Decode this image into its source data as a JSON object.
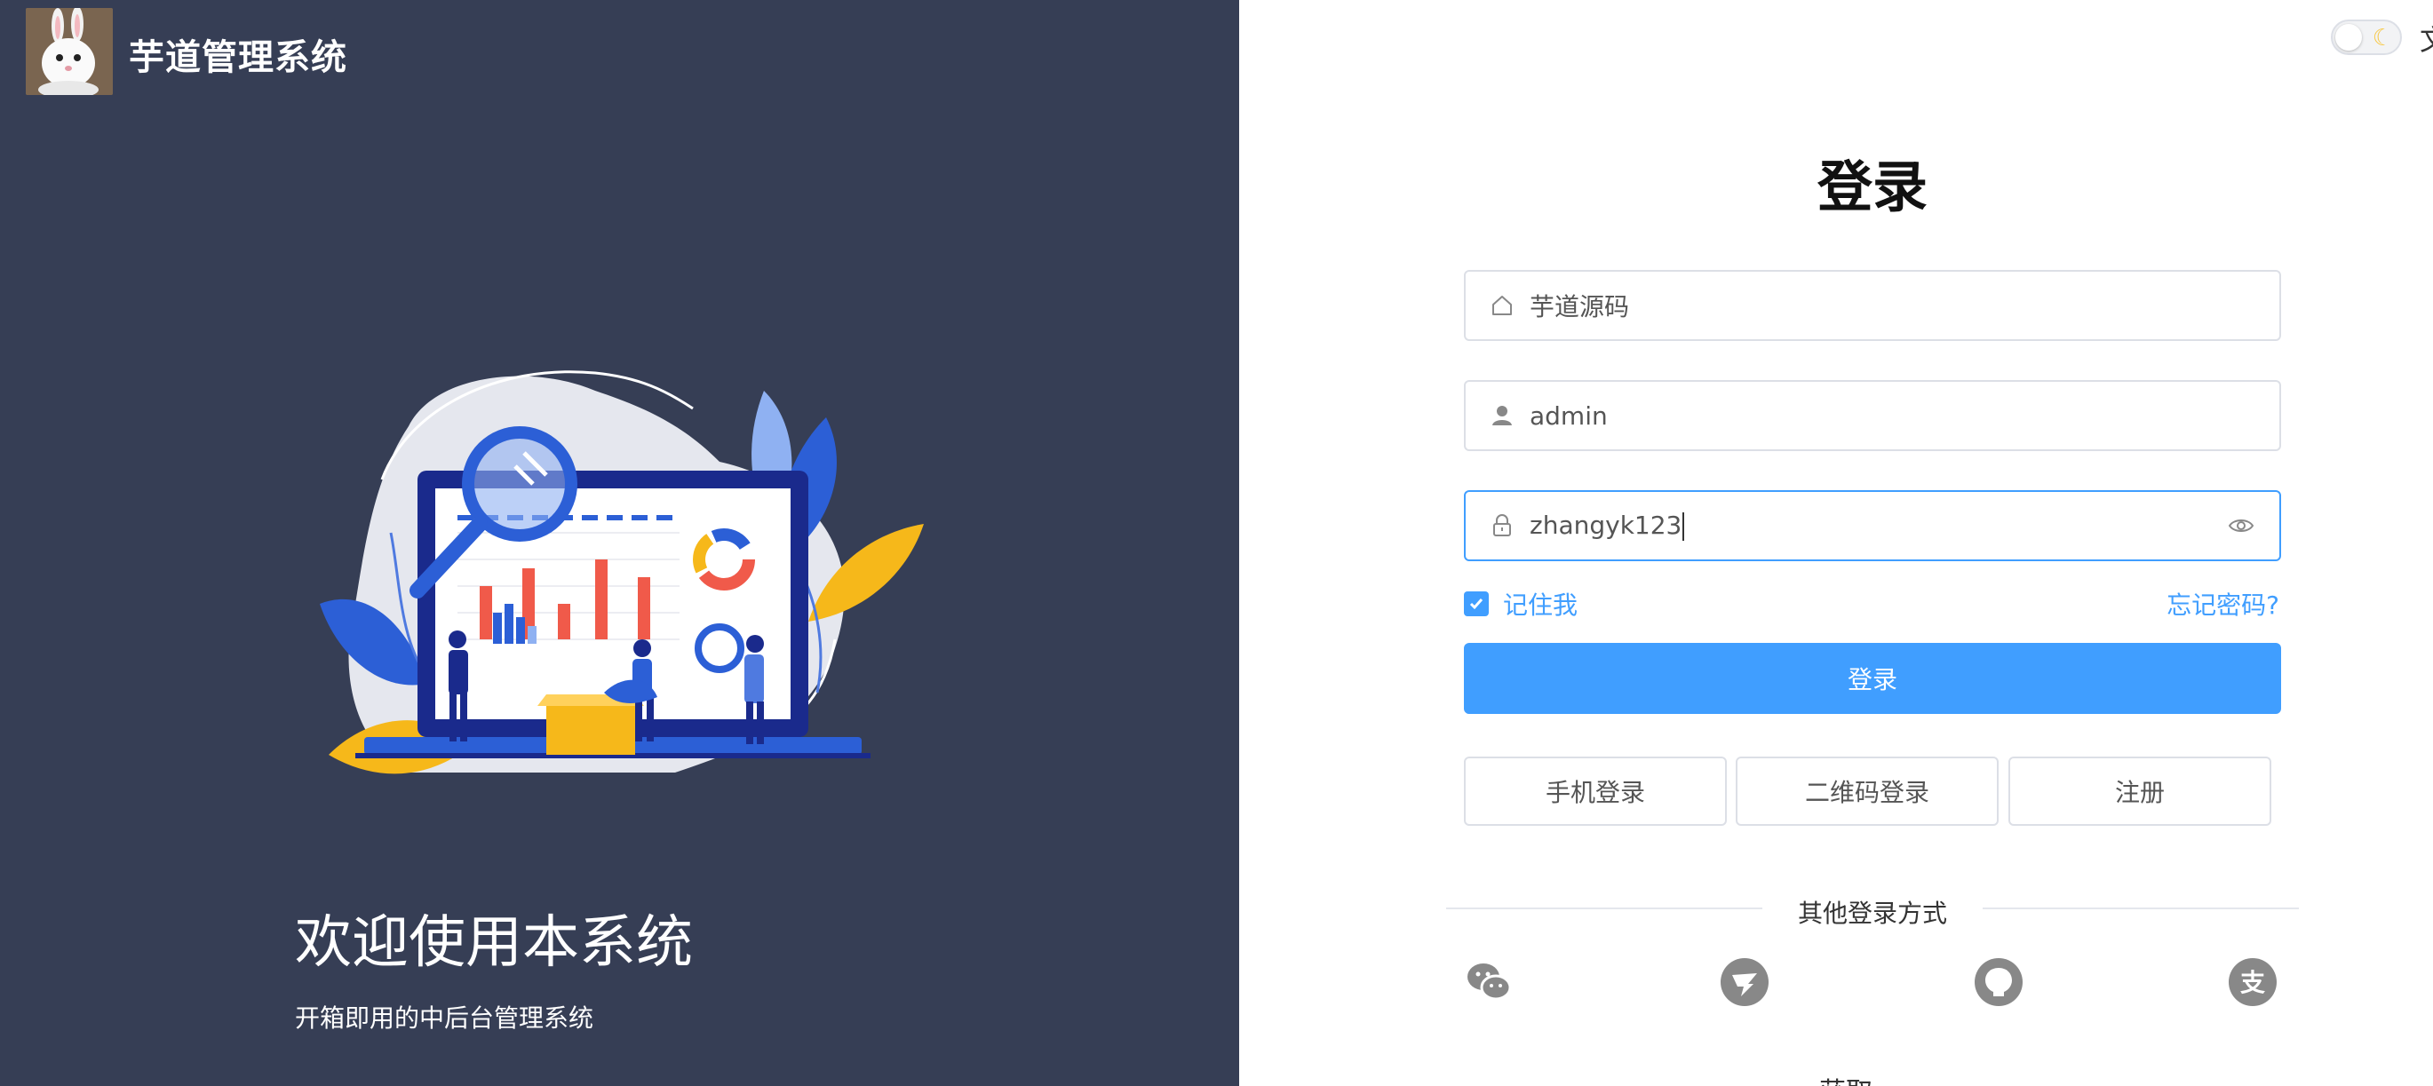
{
  "app": {
    "title": "芋道管理系统"
  },
  "welcome": {
    "title": "欢迎使用本系统",
    "subtitle": "开箱即用的中后台管理系统"
  },
  "header": {
    "lang_label": "文"
  },
  "login": {
    "title": "登录",
    "tenant": {
      "value": "芋道源码",
      "icon": "home-icon"
    },
    "username": {
      "value": "admin",
      "icon": "user-icon"
    },
    "password": {
      "value": "zhangyk123",
      "icon": "lock-icon",
      "toggle_icon": "eye-icon"
    },
    "remember_label": "记住我",
    "remember_checked": true,
    "forgot_label": "忘记密码?",
    "submit_label": "登录"
  },
  "alt_logins": [
    {
      "label": "手机登录"
    },
    {
      "label": "二维码登录"
    },
    {
      "label": "注册"
    }
  ],
  "other_login": {
    "label": "其他登录方式",
    "providers": [
      "wechat-icon",
      "dingtalk-icon",
      "github-icon",
      "alipay-icon"
    ]
  },
  "footer_partial": "获取…",
  "colors": {
    "accent": "#409eff",
    "left_bg": "#363e55",
    "border": "#dcdfe6"
  }
}
